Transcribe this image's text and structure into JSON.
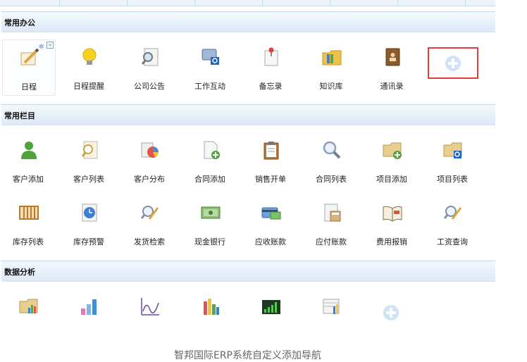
{
  "sections": {
    "office": {
      "title": "常用办公"
    },
    "columns": {
      "title": "常用栏目"
    },
    "analysis": {
      "title": "数据分析"
    }
  },
  "office_items": [
    {
      "label": "日程",
      "icon": "pencil-paper-icon"
    },
    {
      "label": "日程提醒",
      "icon": "lightbulb-icon"
    },
    {
      "label": "公司公告",
      "icon": "magnifier-document-icon"
    },
    {
      "label": "工作互动",
      "icon": "chat-monitor-icon"
    },
    {
      "label": "备忘录",
      "icon": "pin-note-icon"
    },
    {
      "label": "知识库",
      "icon": "folder-books-icon"
    },
    {
      "label": "通讯录",
      "icon": "address-book-icon"
    }
  ],
  "column_items_row1": [
    {
      "label": "客户添加",
      "icon": "user-green-icon"
    },
    {
      "label": "客户列表",
      "icon": "magnifier-list-icon"
    },
    {
      "label": "客户分布",
      "icon": "pie-chart-doc-icon"
    },
    {
      "label": "合同添加",
      "icon": "document-add-icon"
    },
    {
      "label": "销售开单",
      "icon": "clipboard-icon"
    },
    {
      "label": "合同列表",
      "icon": "search-icon"
    },
    {
      "label": "项目添加",
      "icon": "folder-add-icon"
    },
    {
      "label": "项目列表",
      "icon": "folder-search-icon"
    }
  ],
  "column_items_row2": [
    {
      "label": "库存列表",
      "icon": "abacus-icon"
    },
    {
      "label": "库存预警",
      "icon": "clock-doc-icon"
    },
    {
      "label": "发货检索",
      "icon": "magnifier-pencil-icon"
    },
    {
      "label": "现金银行",
      "icon": "cash-icon"
    },
    {
      "label": "应收账款",
      "icon": "credit-card-icon"
    },
    {
      "label": "应付账款",
      "icon": "calculator-doc-icon"
    },
    {
      "label": "费用报销",
      "icon": "open-book-icon"
    },
    {
      "label": "工资查询",
      "icon": "search-pencil-icon"
    }
  ],
  "analysis_icons": [
    "folder-chart-icon",
    "bar-chart-icon",
    "line-chart-icon",
    "column-chart-icon",
    "growth-chart-icon",
    "table-chart-icon"
  ],
  "caption": "智邦国际ERP系统自定义添加导航",
  "colors": {
    "accent": "#e53b3b",
    "header_bg": "#dde9f6"
  }
}
